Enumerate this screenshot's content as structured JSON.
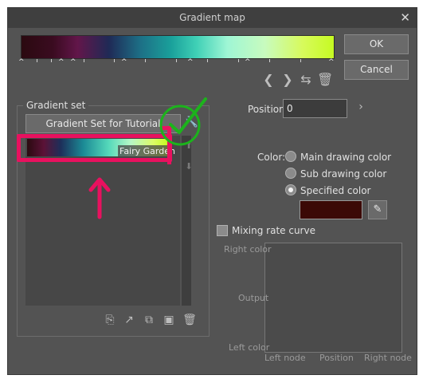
{
  "window": {
    "title": "Gradient map",
    "close_icon": "close-icon"
  },
  "buttons": {
    "ok": "OK",
    "cancel": "Cancel"
  },
  "gradient_set": {
    "group_label": "Gradient set",
    "dropdown_value": "Gradient Set for Tutorial",
    "selected_item_name": "Fairy Garden"
  },
  "position": {
    "label": "Position:",
    "value": "0"
  },
  "color": {
    "label": "Color:",
    "options": [
      "Main drawing color",
      "Sub drawing color",
      "Specified color"
    ],
    "selected": "Specified color",
    "specified_swatch": "#3b0906"
  },
  "mixing": {
    "checkbox_label": "Mixing rate curve",
    "graph": {
      "right_color": "Right color",
      "output": "Output",
      "left_color": "Left color",
      "left_node": "Left node",
      "position": "Position",
      "right_node": "Right node"
    }
  },
  "annotation": {
    "highlight_color": "#e8115f",
    "check_color": "#1cb31c"
  }
}
